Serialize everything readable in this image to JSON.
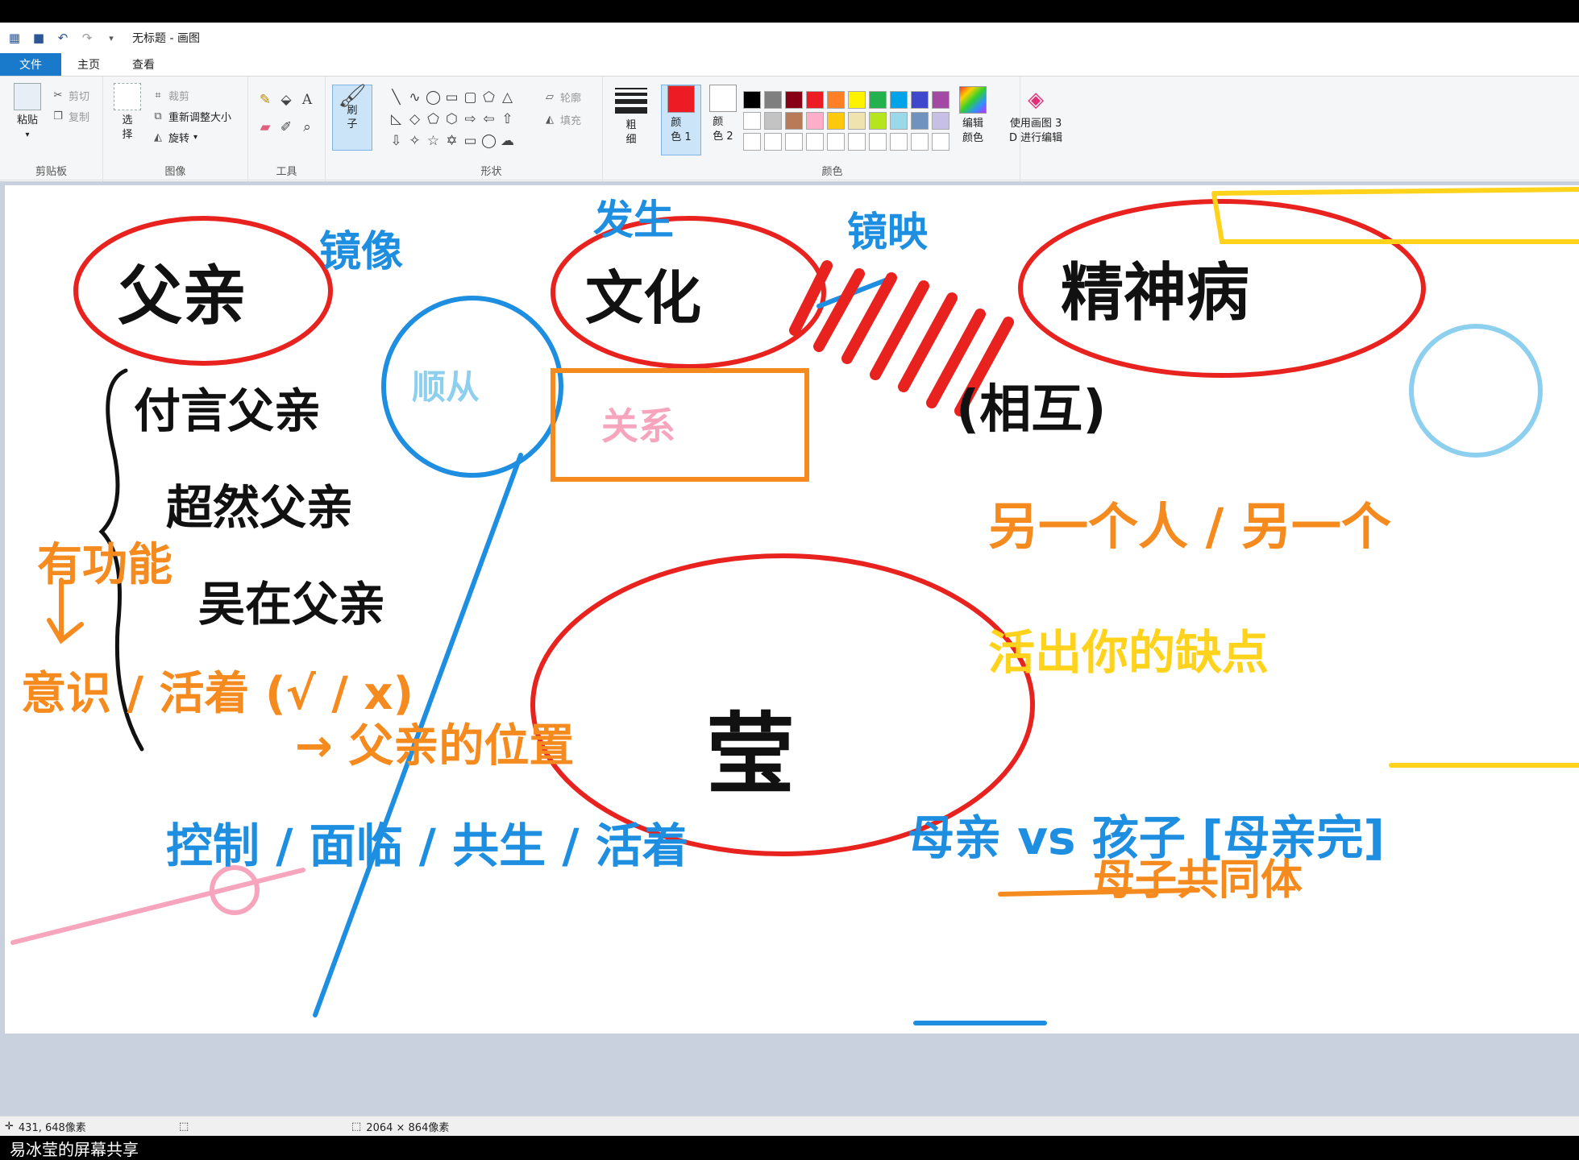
{
  "window": {
    "title": "无标题 - 画图"
  },
  "quick_access": {
    "icons": [
      "paint-app-icon",
      "save-icon",
      "undo-icon",
      "redo-icon",
      "customize-icon"
    ]
  },
  "tabs": [
    {
      "label": "文件",
      "active": true
    },
    {
      "label": "主页",
      "active": false
    },
    {
      "label": "查看",
      "active": false
    }
  ],
  "ribbon": {
    "clipboard": {
      "paste": "粘贴",
      "cut": "剪切",
      "copy": "复制",
      "label": "剪贴板"
    },
    "image": {
      "select": "选\n择",
      "crop": "裁剪",
      "resize": "重新调整大小",
      "rotate": "旋转",
      "label": "图像"
    },
    "tools": {
      "label": "工具"
    },
    "brush": {
      "label": "刷\n子"
    },
    "shapes": {
      "outline": "轮廓",
      "fill": "填充",
      "label": "形状"
    },
    "size": {
      "label": "粗\n细"
    },
    "color1": {
      "label": "颜\n色 1",
      "color": "#ed1c24"
    },
    "color2": {
      "label": "颜\n色 2",
      "color": "#ffffff"
    },
    "colors": {
      "label": "颜色",
      "edit": "编辑\n颜色"
    },
    "paint3d": {
      "label": "使用画图 3\nD 进行编辑"
    },
    "palette_row1": [
      "#000000",
      "#7f7f7f",
      "#880015",
      "#ed1c24",
      "#ff7f27",
      "#fff200",
      "#22b14c",
      "#00a2e8",
      "#3f48cc",
      "#a349a4"
    ],
    "palette_row2": [
      "#ffffff",
      "#c3c3c3",
      "#b97a57",
      "#ffaec9",
      "#ffc90e",
      "#efe4b0",
      "#b5e61d",
      "#99d9ea",
      "#7092be",
      "#c8bfe7"
    ]
  },
  "status": {
    "cursor": "431, 648像素",
    "canvas_size": "2064 × 864像素"
  },
  "caption": "易冰莹的屏幕共享",
  "drawing": {
    "father": "父亲",
    "type1": "付言父亲",
    "type2": "超然父亲",
    "type3": "吴在父亲",
    "mirror": "镜像",
    "occur": "发生",
    "reflect": "镜映",
    "culture": "文化",
    "mental": "精神病",
    "mutual": "(相互)",
    "follow": "顺从",
    "relation": "关系",
    "ying": "莹",
    "another": "另一个人 / 另一个",
    "alive": "活出你的缺点",
    "mother": "母亲 vs 孩子 [母亲完]",
    "mother_child": "母子共同体",
    "consciousness": "意识 / 活着 (√ / x)",
    "father_position": "→ 父亲的位置",
    "control": "控制 / 面临 / 共生 / 活着",
    "has_function": "有功能"
  }
}
